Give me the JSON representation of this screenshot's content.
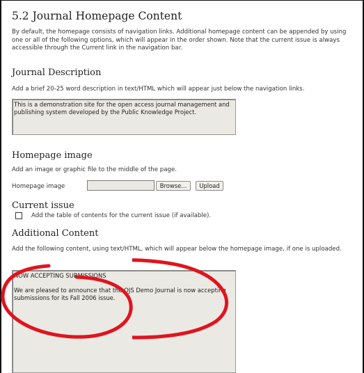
{
  "section": {
    "title": "5.2 Journal Homepage Content",
    "intro": "By default, the homepage consists of navigation links. Additional homepage content can be appended by using one or all of the following options, which will appear in the order shown. Note that the current issue is always accessible through the Current link in the navigation bar."
  },
  "description": {
    "heading": "Journal Description",
    "help": "Add a brief 20-25 word description in text/HTML which will appear just below the navigation links.",
    "value": "This is a demonstration site for the open access journal management and publishing system developed by the Public Knowledge Project."
  },
  "homepage_image": {
    "heading": "Homepage image",
    "help": "Add an image or graphic file to the middle of the page.",
    "label": "Homepage image",
    "browse_label": "Browse...",
    "upload_label": "Upload"
  },
  "current_issue": {
    "heading": "Current issue",
    "checkbox_label": "Add the table of contents for the current issue (if available)."
  },
  "additional": {
    "heading": "Additional Content",
    "help": "Add the following content, using text/HTML, which will appear below the homepage image, if one is uploaded.",
    "value": "NOW ACCEPTING SUBMISSIONS\n\nWe are pleased to announce that the OJS Demo Journal is now accepting submissions for its Fall 2006 issue."
  },
  "colors": {
    "annotation": "#e0141e",
    "field_bg": "#ebe9e3"
  }
}
